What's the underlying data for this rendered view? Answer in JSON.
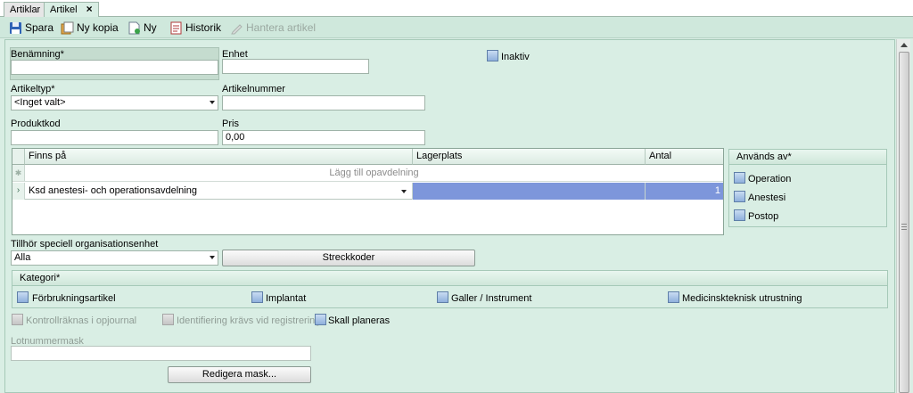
{
  "tabs": [
    {
      "label": "Artiklar"
    },
    {
      "label": "Artikel"
    }
  ],
  "toolbar": {
    "save": "Spara",
    "copy": "Ny kopia",
    "new": "Ny",
    "history": "Historik",
    "manage": "Hantera artikel"
  },
  "form": {
    "name_label": "Benämning*",
    "name_value": "",
    "unit_label": "Enhet",
    "unit_value": "",
    "inactive_label": "Inaktiv",
    "type_label": "Artikeltyp*",
    "type_value": "<Inget valt>",
    "number_label": "Artikelnummer",
    "number_value": "",
    "productcode_label": "Produktkod",
    "productcode_value": "",
    "price_label": "Pris",
    "price_value": "0,00"
  },
  "grid": {
    "columns": [
      "Finns på",
      "Lagerplats",
      "Antal"
    ],
    "new_row_text": "Lägg till opavdelning",
    "rows": [
      {
        "location": "Ksd anestesi- och operationsavdelning",
        "storage": "",
        "count": "1"
      }
    ]
  },
  "used_by": {
    "title": "Används av*",
    "items": [
      "Operation",
      "Anestesi",
      "Postop"
    ]
  },
  "org": {
    "label": "Tillhör speciell organisationsenhet",
    "value": "Alla",
    "barcodes_button": "Streckkoder"
  },
  "category": {
    "title": "Kategori*",
    "items": [
      "Förbrukningsartikel",
      "Implantat",
      "Galler / Instrument",
      "Medicinskteknisk utrustning"
    ]
  },
  "options": {
    "count_check": "Kontrollräknas i opjournal",
    "ident_required": "Identifiering krävs vid registrering",
    "planned": "Skall planeras"
  },
  "lot": {
    "label": "Lotnummermask",
    "value": "",
    "edit_button": "Redigera mask..."
  }
}
